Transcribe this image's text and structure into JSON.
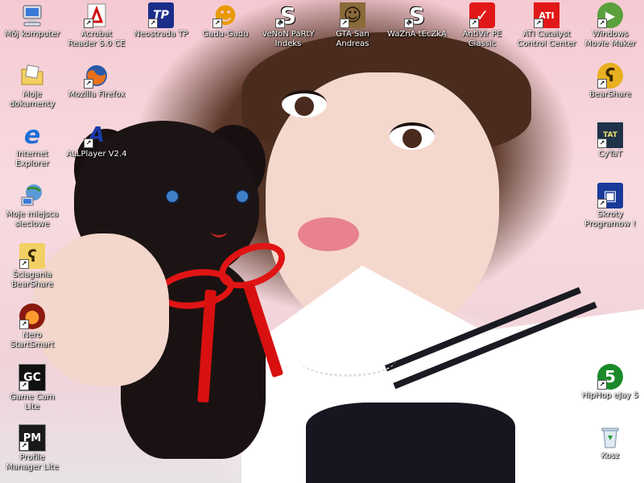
{
  "desktop": {
    "icons": [
      {
        "label": "Mój komputer",
        "icon": "computer-icon",
        "glyph": "",
        "bg": "#6fa0d8",
        "fg": "#fff",
        "shortcut": false
      },
      {
        "label": "Acrobat Reader 5.0 CE",
        "icon": "acrobat-icon",
        "glyph": "A",
        "bg": "#ffffff",
        "fg": "#d01010",
        "shortcut": true
      },
      {
        "label": "Neostrada TP",
        "icon": "neostrada-icon",
        "glyph": "TP",
        "bg": "#1a2e8a",
        "fg": "#ffffff",
        "shortcut": true
      },
      {
        "label": "Gadu-Gadu",
        "icon": "gadu-gadu-icon",
        "glyph": "☻",
        "bg": "#ffd21a",
        "fg": "#d23a00",
        "shortcut": true
      },
      {
        "label": "VeNoN PaRtY Indeks",
        "icon": "venon-icon",
        "glyph": "S",
        "bg": "#ffffff",
        "fg": "#111111",
        "shortcut": true
      },
      {
        "label": "GTA San Andreas",
        "icon": "gta-icon",
        "glyph": "☺",
        "bg": "#8a6a3a",
        "fg": "#222",
        "shortcut": true
      },
      {
        "label": "WaZnA tEcZkA",
        "icon": "wazna-teczka-icon",
        "glyph": "S",
        "bg": "#ffffff",
        "fg": "#111111",
        "shortcut": true
      },
      {
        "label": "AntiVir PE Classic",
        "icon": "antivir-icon",
        "glyph": "✓",
        "bg": "#e01818",
        "fg": "#ffffff",
        "shortcut": true
      },
      {
        "label": "ATI Catalyst Control Center",
        "icon": "ati-icon",
        "glyph": "ATI",
        "bg": "#e01818",
        "fg": "#ffffff",
        "shortcut": true
      },
      {
        "label": "Windows Movie Maker",
        "icon": "movie-maker-icon",
        "glyph": "▶",
        "bg": "#5aa03c",
        "fg": "#ffffff",
        "shortcut": true
      },
      {
        "label": "Moje dokumenty",
        "icon": "my-documents-icon",
        "glyph": "",
        "bg": "#f3d063",
        "fg": "#fff",
        "shortcut": false
      },
      {
        "label": "Mozilla Firefox",
        "icon": "firefox-icon",
        "glyph": "",
        "bg": "#e8701a",
        "fg": "#fff",
        "shortcut": true
      },
      {
        "label": "BearShare",
        "icon": "bearshare-icon",
        "glyph": "ʕ",
        "bg": "#e8b020",
        "fg": "#3a2a00",
        "shortcut": true
      },
      {
        "label": "Internet Explorer",
        "icon": "internet-explorer-icon",
        "glyph": "e",
        "bg": "#ffffff",
        "fg": "#1e6fd8",
        "shortcut": false
      },
      {
        "label": "ALLPlayer V2.4",
        "icon": "allplayer-icon",
        "glyph": "A",
        "bg": "#ffffff",
        "fg": "#1a3aa8",
        "shortcut": true
      },
      {
        "label": "CyTaT",
        "icon": "cytat-icon",
        "glyph": "TAT",
        "bg": "#20324a",
        "fg": "#e8e070",
        "shortcut": true
      },
      {
        "label": "Moje miejsca sieciowe",
        "icon": "network-places-icon",
        "glyph": "",
        "bg": "#5a8fd0",
        "fg": "#fff",
        "shortcut": false
      },
      {
        "label": "Skroty Programow !",
        "icon": "shortcuts-folder-icon",
        "glyph": "▣",
        "bg": "#1a3a9a",
        "fg": "#ffffff",
        "shortcut": true
      },
      {
        "label": "Ściagania BearShare",
        "icon": "bearshare-downloads-icon",
        "glyph": "ʕ",
        "bg": "#f3d063",
        "fg": "#3a2a00",
        "shortcut": true
      },
      {
        "label": "Nero StartSmart",
        "icon": "nero-icon",
        "glyph": "●",
        "bg": "#8a1a10",
        "fg": "#ff9a30",
        "shortcut": true
      },
      {
        "label": "Game Cam Lite",
        "icon": "game-cam-icon",
        "glyph": "GC",
        "bg": "#111111",
        "fg": "#ffffff",
        "shortcut": true
      },
      {
        "label": "HipHop eJay 5",
        "icon": "hiphop-ejay-icon",
        "glyph": "5",
        "bg": "#1a8a2a",
        "fg": "#ffffff",
        "shortcut": true
      },
      {
        "label": "Profile Manager Lite",
        "icon": "profile-manager-icon",
        "glyph": "PM",
        "bg": "#1a1a1a",
        "fg": "#ffffff",
        "shortcut": true
      },
      {
        "label": "Kosz",
        "icon": "recycle-bin-icon",
        "glyph": "♻",
        "bg": "#dfe9f2",
        "fg": "#2a7a3a",
        "shortcut": false
      }
    ]
  }
}
